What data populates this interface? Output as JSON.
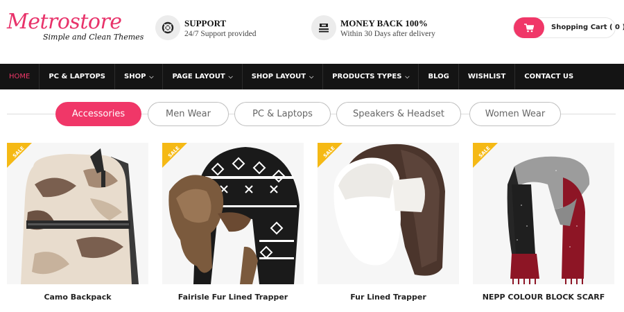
{
  "brand": {
    "logo_text": "Metrostore",
    "tagline": "Simple and Clean Themes"
  },
  "features": [
    {
      "title": "SUPPORT",
      "subtitle": "24/7 Support provided",
      "icon": "lifebuoy-icon"
    },
    {
      "title": "MONEY BACK 100%",
      "subtitle": "Within 30 Days after delivery",
      "icon": "money-stack-icon"
    }
  ],
  "cart": {
    "label": "Shopping Cart ( 0 )",
    "icon": "shopping-cart-icon"
  },
  "nav": {
    "items": [
      {
        "label": "HOME",
        "dropdown": false
      },
      {
        "label": "PC & LAPTOPS",
        "dropdown": false
      },
      {
        "label": "SHOP",
        "dropdown": true
      },
      {
        "label": "PAGE LAYOUT",
        "dropdown": true
      },
      {
        "label": "SHOP LAYOUT",
        "dropdown": true
      },
      {
        "label": "PRODUCTS TYPES",
        "dropdown": true
      },
      {
        "label": "BLOG",
        "dropdown": false
      },
      {
        "label": "WISHLIST",
        "dropdown": false
      },
      {
        "label": "CONTACT US",
        "dropdown": false
      }
    ],
    "active": "HOME"
  },
  "tabs": {
    "items": [
      "Accessories",
      "Men Wear",
      "PC & Laptops",
      "Speakers & Headset",
      "Women Wear"
    ],
    "active": "Accessories"
  },
  "products": [
    {
      "name": "Camo Backpack",
      "badge": "SALE"
    },
    {
      "name": "Fairisle Fur Lined Trapper",
      "badge": "SALE"
    },
    {
      "name": "Fur Lined Trapper",
      "badge": "SALE"
    },
    {
      "name": "NEPP COLOUR BLOCK SCARF",
      "badge": "SALE"
    }
  ],
  "colors": {
    "accent": "#f03768",
    "nav_bg": "#141414",
    "badge": "#f5b915"
  }
}
